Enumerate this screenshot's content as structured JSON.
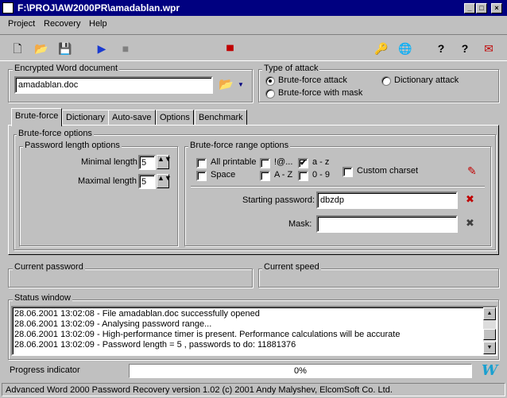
{
  "window": {
    "title": "F:\\PROJ\\AW2000PR\\amadablan.wpr",
    "min_glyph": "_",
    "max_glyph": "□",
    "close_glyph": "×"
  },
  "menu": {
    "items": [
      "Project",
      "Recovery",
      "Help"
    ]
  },
  "toolbar": {
    "new_glyph": "🗋",
    "open_glyph": "📂",
    "save_glyph": "💾",
    "start_glyph": "▶",
    "stop_glyph": "■",
    "benchmark_glyph": "▮▮▮",
    "key_glyph": "🔑",
    "globe_glyph": "🌐",
    "help1_glyph": "?",
    "help2_glyph": "?",
    "exit_glyph": "✉"
  },
  "encrypted_doc": {
    "label": "Encrypted Word document",
    "value": "amadablan.doc",
    "browse_glyph": "📂",
    "dropdown_glyph": "▼"
  },
  "attack_type": {
    "label": "Type of attack",
    "brute_force": "Brute-force attack",
    "dictionary": "Dictionary attack",
    "brute_force_mask": "Brute-force with mask",
    "selected": "brute_force"
  },
  "tabs": [
    {
      "label": "Brute-force",
      "active": true
    },
    {
      "label": "Dictionary",
      "active": false
    },
    {
      "label": "Auto-save",
      "active": false
    },
    {
      "label": "Options",
      "active": false
    },
    {
      "label": "Benchmark",
      "active": false
    }
  ],
  "brute_force": {
    "group_label": "Brute-force options",
    "length": {
      "label": "Password length options",
      "min_label": "Minimal length",
      "min_value": "5",
      "max_label": "Maximal length",
      "max_value": "5",
      "spin_glyph": "▲▼"
    },
    "range": {
      "label": "Brute-force range options",
      "all_printable": "All printable",
      "symbols": "!@...",
      "lower": "a - z",
      "space": "Space",
      "upper": "A - Z",
      "digits": "0 - 9",
      "custom": "Custom charset",
      "check_glyph": "✔",
      "edit_glyph": "✎"
    },
    "starting_password_label": "Starting password:",
    "starting_password_value": "dbzdp",
    "mask_label": "Mask:",
    "mask_value": "",
    "clear_glyph": "✖"
  },
  "current_password_label": "Current password",
  "current_speed_label": "Current speed",
  "status": {
    "label": "Status window",
    "lines": [
      "28.06.2001 13:02:08 - File amadablan.doc successfully opened",
      "28.06.2001 13:02:09 - Analysing password range...",
      "28.06.2001 13:02:09 - High-performance timer is present. Performance calculations will be accurate",
      "28.06.2001 13:02:09 - Password length = 5 , passwords to do: 11881376"
    ],
    "up_glyph": "▲",
    "down_glyph": "▼"
  },
  "progress": {
    "label": "Progress indicator",
    "text": "0%",
    "value": 0,
    "logo_glyph": "W"
  },
  "statusbar": {
    "text": "Advanced Word 2000 Password Recovery version 1.02 (c) 2001 Andy Malyshev, ElcomSoft Co. Ltd."
  },
  "colors": {
    "titlebar": "#000080",
    "face": "#c0c0c0",
    "start_icon": "#1a3ad0"
  }
}
